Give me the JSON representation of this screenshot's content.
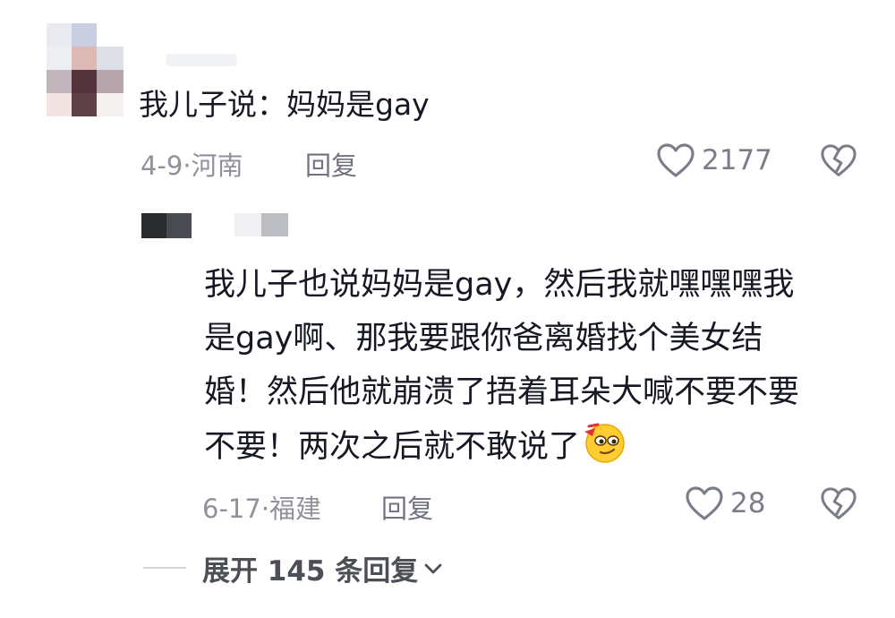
{
  "comment": {
    "text": "我儿子说：妈妈是gay",
    "date": "4-9",
    "location": "河南",
    "reply_label": "回复",
    "like_count": "2177",
    "like_icon": "heart-outline-icon",
    "dislike_icon": "broken-heart-icon"
  },
  "reply": {
    "lines": [
      "我儿子也说妈妈是gay，然后我就嘿嘿嘿我",
      "是gay啊、那我要跟你爸离婚找个美女结",
      "婚！然后他就崩溃了捂着耳朵大喊不要不要",
      "不要！两次之后就不敢说了"
    ],
    "emoji_icon": "smirk-emoji-icon",
    "date": "6-17",
    "location": "福建",
    "reply_label": "回复",
    "like_count": "28"
  },
  "expand": {
    "label": "展开 145 条回复"
  }
}
